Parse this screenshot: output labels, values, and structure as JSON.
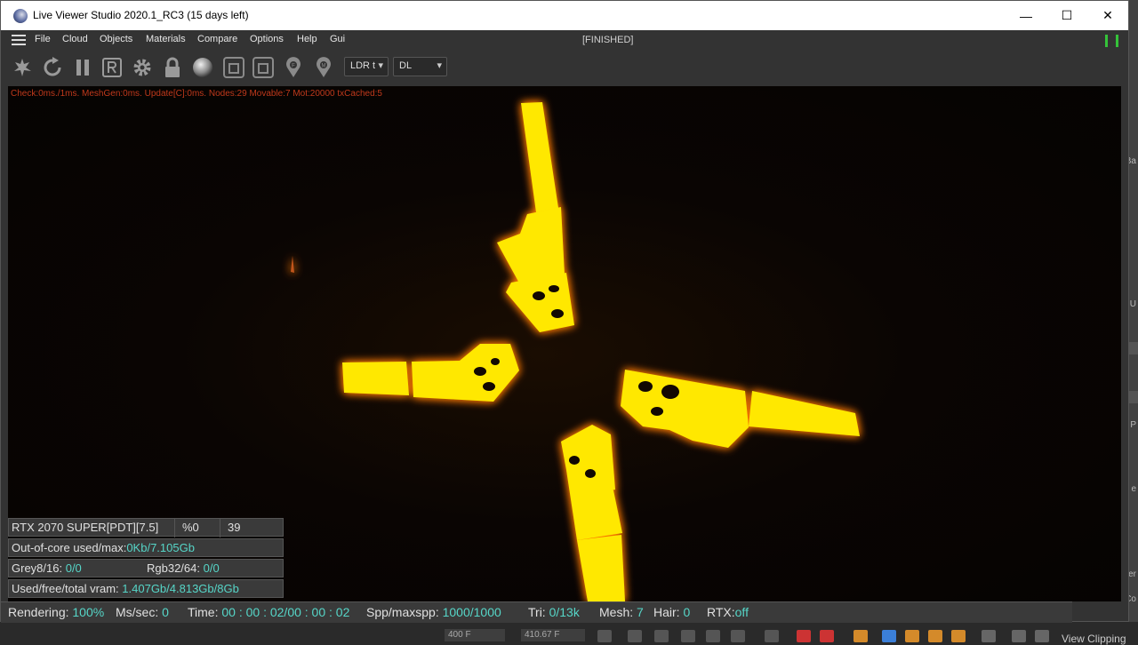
{
  "window": {
    "title": "Live Viewer Studio 2020.1_RC3 (15 days left)",
    "minimize_glyph": "—",
    "maximize_glyph": "☐",
    "close_glyph": "✕"
  },
  "menu": {
    "items": [
      "File",
      "Cloud",
      "Objects",
      "Materials",
      "Compare",
      "Options",
      "Help",
      "Gui"
    ],
    "status": "[FINISHED]"
  },
  "toolbar": {
    "icons": [
      "send-scene-icon",
      "restart-icon",
      "pause-icon",
      "region-render-icon",
      "settings-gear-icon",
      "lock-icon",
      "material-ball-icon",
      "clay-mode-icon",
      "clay-mode-alt-icon",
      "pick-focus-icon",
      "pick-material-icon"
    ],
    "tonemap_select": "LDR t",
    "kernel_select": "DL"
  },
  "viewport": {
    "debug_line": "Check:0ms./1ms. MeshGen:0ms. Update[C]:0ms. Nodes:29 Movable:7 Mot:20000 txCached:5",
    "accent_color": "#ffe800"
  },
  "stats": {
    "gpu_name": "RTX 2070 SUPER[PDT][7.5]",
    "gpu_percent": "%0",
    "gpu_temp": "39",
    "ooc_label": "Out-of-core used/max:",
    "ooc_value": "0Kb/7.105Gb",
    "grey_label": "Grey8/16:",
    "grey_value": "0/0",
    "rgb_label": "Rgb32/64:",
    "rgb_value": "0/0",
    "vram_label": "Used/free/total vram:",
    "vram_value": "1.407Gb/4.813Gb/8Gb"
  },
  "statusbar": {
    "rendering_label": "Rendering:",
    "rendering_value": "100%",
    "ms_label": "Ms/sec:",
    "ms_value": "0",
    "time_label": "Time:",
    "time_value": "00 : 00 : 02/00 : 00 : 02",
    "spp_label": "Spp/maxspp:",
    "spp_value": "1000/1000",
    "tri_label": "Tri:",
    "tri_value": "0/13k",
    "mesh_label": "Mesh:",
    "mesh_value": "7",
    "hair_label": "Hair:",
    "hair_value": "0",
    "rtx_label": "RTX:",
    "rtx_value": "off"
  },
  "host": {
    "field_1": "400 F",
    "field_2": "410.67 F",
    "view_clipping": "View Clipping",
    "right_labels": [
      "Ba",
      "U",
      "P",
      "e",
      "er",
      "Co"
    ]
  }
}
